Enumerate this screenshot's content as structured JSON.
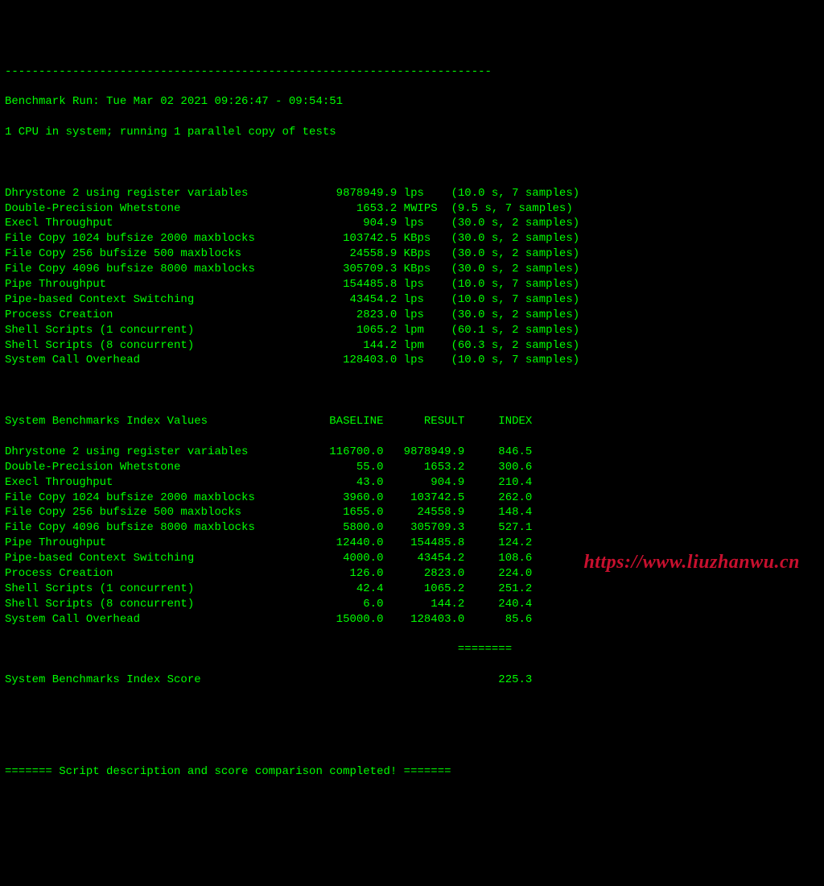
{
  "top_divider": "------------------------------------------------------------------------",
  "header": {
    "run_line": "Benchmark Run: Tue Mar 02 2021 09:26:47 - 09:54:51",
    "cpu_line": "1 CPU in system; running 1 parallel copy of tests"
  },
  "run_results": [
    {
      "name": "Dhrystone 2 using register variables",
      "value": "9878949.9",
      "unit": "lps",
      "timing": "(10.0 s, 7 samples)"
    },
    {
      "name": "Double-Precision Whetstone",
      "value": "1653.2",
      "unit": "MWIPS",
      "timing": "(9.5 s, 7 samples)"
    },
    {
      "name": "Execl Throughput",
      "value": "904.9",
      "unit": "lps",
      "timing": "(30.0 s, 2 samples)"
    },
    {
      "name": "File Copy 1024 bufsize 2000 maxblocks",
      "value": "103742.5",
      "unit": "KBps",
      "timing": "(30.0 s, 2 samples)"
    },
    {
      "name": "File Copy 256 bufsize 500 maxblocks",
      "value": "24558.9",
      "unit": "KBps",
      "timing": "(30.0 s, 2 samples)"
    },
    {
      "name": "File Copy 4096 bufsize 8000 maxblocks",
      "value": "305709.3",
      "unit": "KBps",
      "timing": "(30.0 s, 2 samples)"
    },
    {
      "name": "Pipe Throughput",
      "value": "154485.8",
      "unit": "lps",
      "timing": "(10.0 s, 7 samples)"
    },
    {
      "name": "Pipe-based Context Switching",
      "value": "43454.2",
      "unit": "lps",
      "timing": "(10.0 s, 7 samples)"
    },
    {
      "name": "Process Creation",
      "value": "2823.0",
      "unit": "lps",
      "timing": "(30.0 s, 2 samples)"
    },
    {
      "name": "Shell Scripts (1 concurrent)",
      "value": "1065.2",
      "unit": "lpm",
      "timing": "(60.1 s, 2 samples)"
    },
    {
      "name": "Shell Scripts (8 concurrent)",
      "value": "144.2",
      "unit": "lpm",
      "timing": "(60.3 s, 2 samples)"
    },
    {
      "name": "System Call Overhead",
      "value": "128403.0",
      "unit": "lps",
      "timing": "(10.0 s, 7 samples)"
    }
  ],
  "index_header": {
    "title": "System Benchmarks Index Values",
    "c1": "BASELINE",
    "c2": "RESULT",
    "c3": "INDEX"
  },
  "index_table": [
    {
      "name": "Dhrystone 2 using register variables",
      "baseline": "116700.0",
      "result": "9878949.9",
      "index": "846.5"
    },
    {
      "name": "Double-Precision Whetstone",
      "baseline": "55.0",
      "result": "1653.2",
      "index": "300.6"
    },
    {
      "name": "Execl Throughput",
      "baseline": "43.0",
      "result": "904.9",
      "index": "210.4"
    },
    {
      "name": "File Copy 1024 bufsize 2000 maxblocks",
      "baseline": "3960.0",
      "result": "103742.5",
      "index": "262.0"
    },
    {
      "name": "File Copy 256 bufsize 500 maxblocks",
      "baseline": "1655.0",
      "result": "24558.9",
      "index": "148.4"
    },
    {
      "name": "File Copy 4096 bufsize 8000 maxblocks",
      "baseline": "5800.0",
      "result": "305709.3",
      "index": "527.1"
    },
    {
      "name": "Pipe Throughput",
      "baseline": "12440.0",
      "result": "154485.8",
      "index": "124.2"
    },
    {
      "name": "Pipe-based Context Switching",
      "baseline": "4000.0",
      "result": "43454.2",
      "index": "108.6"
    },
    {
      "name": "Process Creation",
      "baseline": "126.0",
      "result": "2823.0",
      "index": "224.0"
    },
    {
      "name": "Shell Scripts (1 concurrent)",
      "baseline": "42.4",
      "result": "1065.2",
      "index": "251.2"
    },
    {
      "name": "Shell Scripts (8 concurrent)",
      "baseline": "6.0",
      "result": "144.2",
      "index": "240.4"
    },
    {
      "name": "System Call Overhead",
      "baseline": "15000.0",
      "result": "128403.0",
      "index": "85.6"
    }
  ],
  "score_divider": "                                                                   ========",
  "score_line": {
    "label": "System Benchmarks Index Score",
    "value": "225.3"
  },
  "footer_line": "======= Script description and score comparison completed! =======",
  "watermark": "https://www.liuzhanwu.cn"
}
